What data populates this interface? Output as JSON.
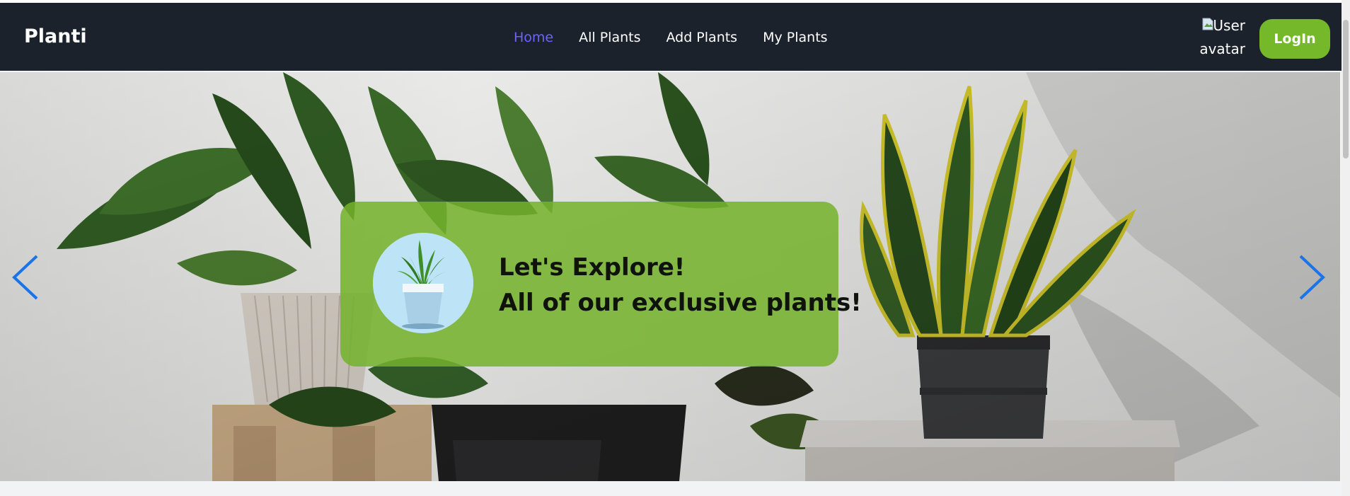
{
  "brand": {
    "name": "Planti"
  },
  "nav": {
    "items": [
      {
        "label": "Home",
        "active": true
      },
      {
        "label": "All Plants",
        "active": false
      },
      {
        "label": "Add Plants",
        "active": false
      },
      {
        "label": "My Plants",
        "active": false
      }
    ]
  },
  "user": {
    "avatar_alt": "User avatar"
  },
  "auth": {
    "login_label": "LogIn"
  },
  "hero": {
    "headline_line1": "Let's Explore!",
    "headline_line2": "All of our exclusive plants!",
    "prev_icon": "chevron-left-icon",
    "next_icon": "chevron-right-icon"
  },
  "colors": {
    "navbar_bg": "#1b222c",
    "active_link": "#6c63ff",
    "login_bg": "#75b82a",
    "overlay_bg": "#74b22c",
    "arrow": "#1a73e8"
  }
}
